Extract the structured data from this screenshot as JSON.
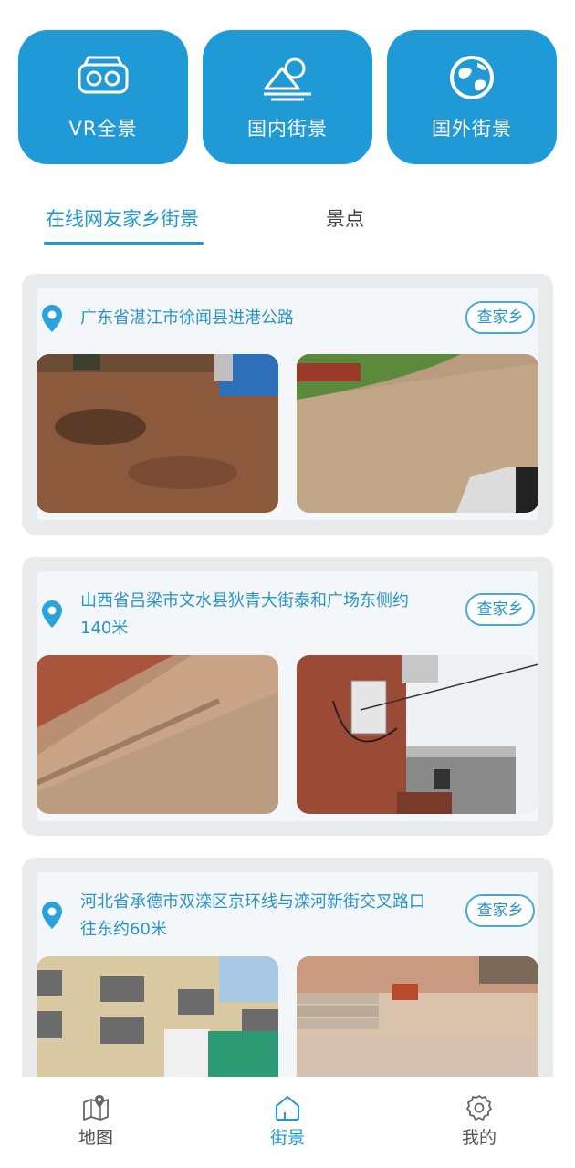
{
  "quick_actions": [
    {
      "label": "VR全景",
      "icon": "vr-goggles-icon"
    },
    {
      "label": "国内街景",
      "icon": "mountain-landscape-icon"
    },
    {
      "label": "国外街景",
      "icon": "globe-icon"
    }
  ],
  "tabs": [
    {
      "label": "在线网友家乡街景",
      "active": true
    },
    {
      "label": "景点",
      "active": false
    }
  ],
  "cards": [
    {
      "address": "广东省湛江市徐闻县进港公路",
      "button": "查家乡"
    },
    {
      "address": "山西省吕梁市文水县狄青大街泰和广场东侧约140米",
      "button": "查家乡"
    },
    {
      "address": "河北省承德市双滦区京环线与滦河新街交叉路口往东约60米",
      "button": "查家乡"
    }
  ],
  "bottom_nav": [
    {
      "label": "地图",
      "icon": "map-pin-icon",
      "active": false
    },
    {
      "label": "街景",
      "icon": "home-icon",
      "active": true
    },
    {
      "label": "我的",
      "icon": "settings-gear-icon",
      "active": false
    }
  ],
  "colors": {
    "accent": "#1f9ad6",
    "text_link": "#2a93c9"
  }
}
